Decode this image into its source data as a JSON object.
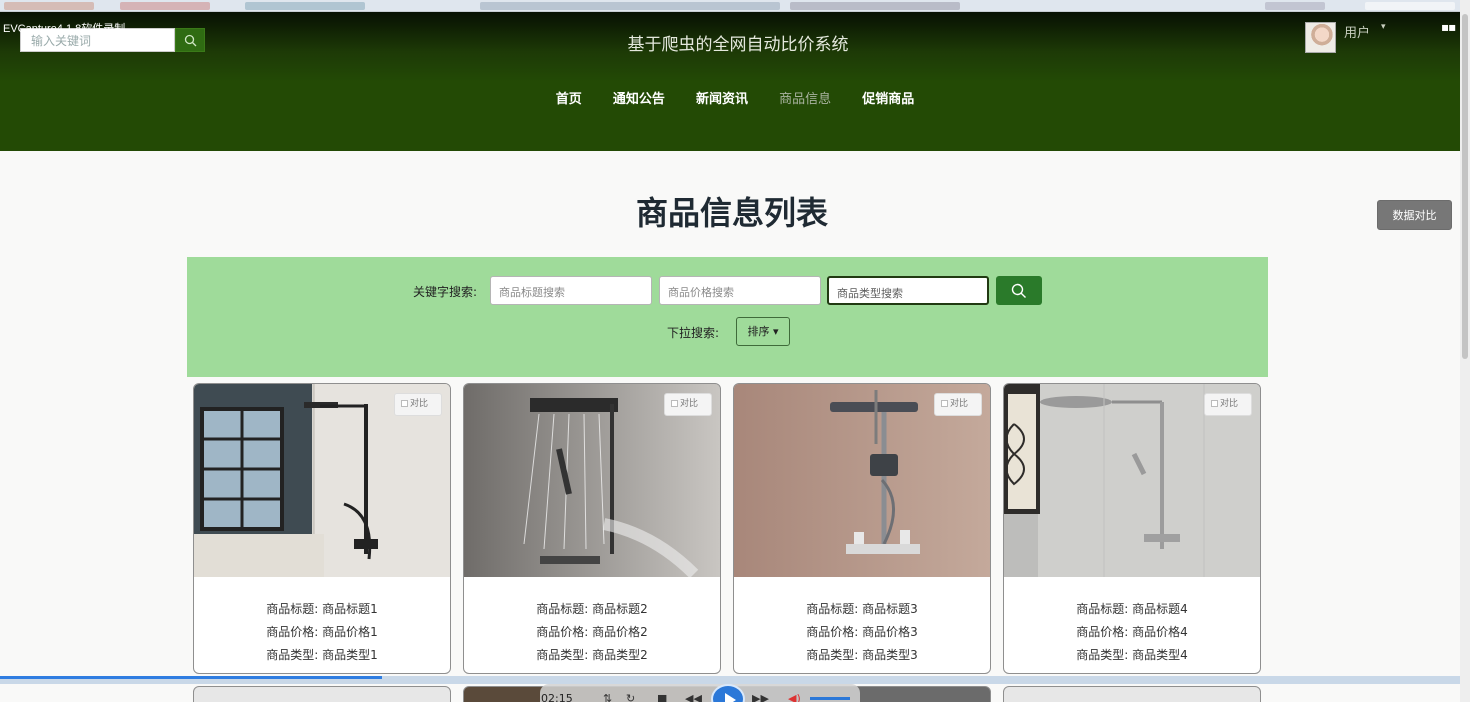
{
  "recorder_watermark": "EVCapture4.1.8软件录制",
  "header": {
    "search_placeholder": "输入关键词",
    "site_title": "基于爬虫的全网自动比价系统",
    "user_label": "用户",
    "nav": [
      {
        "label": "首页"
      },
      {
        "label": "通知公告"
      },
      {
        "label": "新闻资讯"
      },
      {
        "label": "商品信息"
      },
      {
        "label": "促销商品"
      }
    ]
  },
  "compare_button": "数据对比",
  "page_title": "商品信息列表",
  "search_panel": {
    "keyword_label": "关键字搜索:",
    "title_placeholder": "商品标题搜索",
    "price_placeholder": "商品价格搜索",
    "type_placeholder": "商品类型搜索",
    "dropdown_label": "下拉搜索:",
    "sort_label": "排序"
  },
  "products": [
    {
      "compare": "对比",
      "title": "商品标题: 商品标题1",
      "price": "商品价格: 商品价格1",
      "type": "商品类型: 商品类型1"
    },
    {
      "compare": "对比",
      "title": "商品标题: 商品标题2",
      "price": "商品价格: 商品价格2",
      "type": "商品类型: 商品类型2"
    },
    {
      "compare": "对比",
      "title": "商品标题: 商品标题3",
      "price": "商品价格: 商品价格3",
      "type": "商品类型: 商品类型3"
    },
    {
      "compare": "对比",
      "title": "商品标题: 商品标题4",
      "price": "商品价格: 商品价格4",
      "type": "商品类型: 商品类型4"
    }
  ],
  "player": {
    "time": "02:15",
    "progress_fraction": 0.26
  }
}
